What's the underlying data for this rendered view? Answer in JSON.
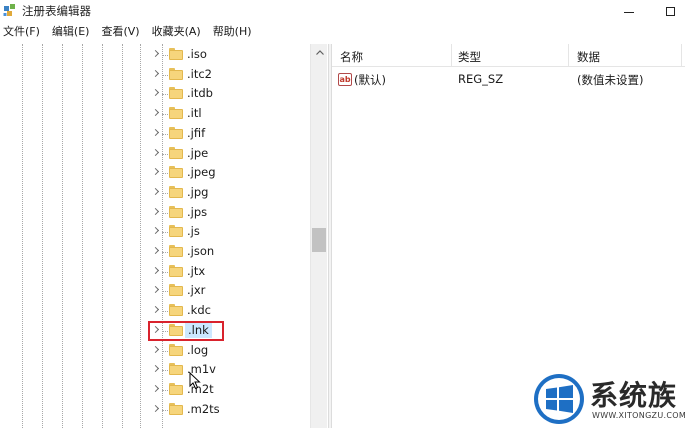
{
  "window": {
    "title": "注册表编辑器"
  },
  "menu": [
    "文件(F)",
    "编辑(E)",
    "查看(V)",
    "收藏夹(A)",
    "帮助(H)"
  ],
  "tree": {
    "items": [
      {
        "label": ".iso"
      },
      {
        "label": ".itc2"
      },
      {
        "label": ".itdb"
      },
      {
        "label": ".itl"
      },
      {
        "label": ".jfif"
      },
      {
        "label": ".jpe"
      },
      {
        "label": ".jpeg"
      },
      {
        "label": ".jpg"
      },
      {
        "label": ".jps"
      },
      {
        "label": ".js"
      },
      {
        "label": ".json"
      },
      {
        "label": ".jtx"
      },
      {
        "label": ".jxr"
      },
      {
        "label": ".kdc"
      },
      {
        "label": ".lnk"
      },
      {
        "label": ".log"
      },
      {
        "label": ".m1v"
      },
      {
        "label": ".m2t"
      },
      {
        "label": ".m2ts"
      }
    ],
    "selected": ".lnk",
    "highlight_color": "#d9232d"
  },
  "list": {
    "columns": [
      "名称",
      "类型",
      "数据"
    ],
    "rows": [
      {
        "name": "(默认)",
        "type": "REG_SZ",
        "data": "(数值未设置)",
        "icon": "string-value-icon"
      }
    ]
  },
  "watermark": {
    "title": "系统族",
    "url": "WWW.XITONGZU.COM"
  },
  "colors": {
    "selection": "#cce8ff",
    "folder": "#f6d57c",
    "watermark_blue": "#1e6fc4"
  }
}
